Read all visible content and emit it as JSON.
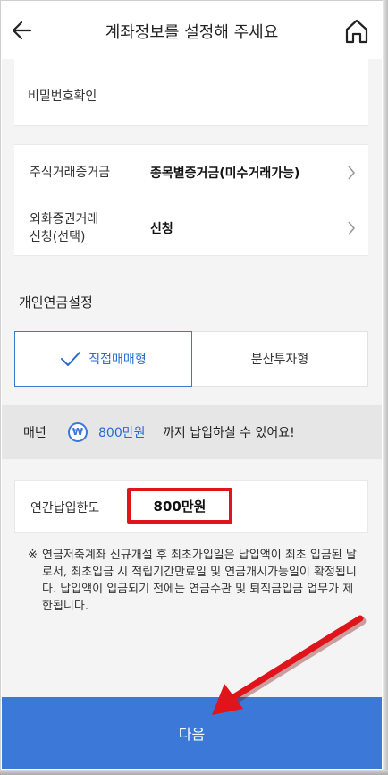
{
  "header": {
    "title": "계좌정보를 설정해 주세요",
    "back_icon": "arrow-left-icon",
    "home_icon": "home-icon"
  },
  "password_confirm": {
    "label": "비밀번호확인"
  },
  "settings": {
    "rows": [
      {
        "label": "주식거래증거금",
        "value": "종목별증거금(미수거래가능)"
      },
      {
        "label": "외화증권거래\n신청(선택)",
        "value": "신청"
      }
    ]
  },
  "pension": {
    "section_title": "개인연금설정",
    "tabs": [
      {
        "label": "직접매매형",
        "selected": true
      },
      {
        "label": "분산투자형",
        "selected": false
      }
    ]
  },
  "banner": {
    "prefix": "매년",
    "currency_icon": "₩",
    "amount": "800만원",
    "suffix": "까지 납입하실 수 있어요!"
  },
  "annual_limit": {
    "label": "연간납입한도",
    "value": "800만원"
  },
  "notice": {
    "mark": "※",
    "text": "연금저축계좌 신규개설 후 최초가입일은 납입액이 최초 입금된 날로서, 최초입금 시 적립기간만료일 및 연금개시가능일이 확정됩니다. 납입액이 입금되기 전에는 연금수관 및 퇴직금입금 업무가 제한됩니다."
  },
  "footer": {
    "next_label": "다음"
  },
  "colors": {
    "accent": "#3b78d8",
    "highlight": "#e0141b",
    "background": "#f4f4f4"
  }
}
